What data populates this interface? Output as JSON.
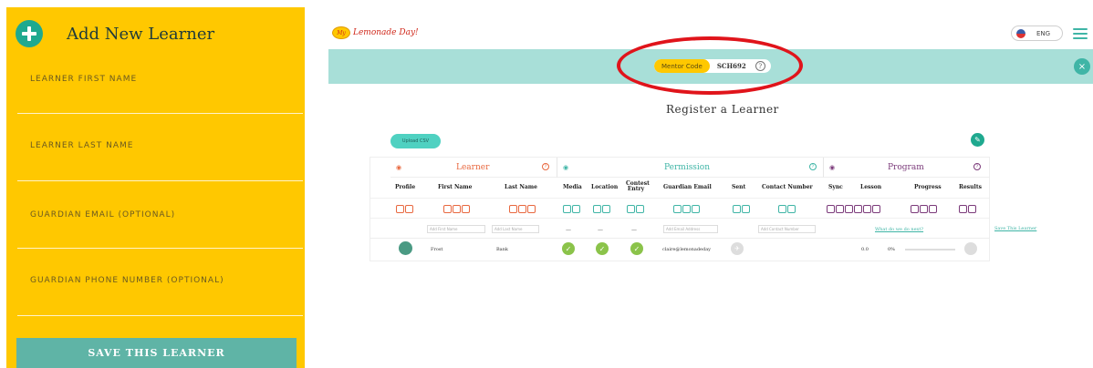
{
  "left_panel": {
    "title": "Add New Learner",
    "fields": [
      {
        "label": "LEARNER FIRST NAME"
      },
      {
        "label": "LEARNER LAST NAME"
      },
      {
        "label": "GUARDIAN EMAIL (OPTIONAL)"
      },
      {
        "label": "GUARDIAN PHONE NUMBER (OPTIONAL)"
      }
    ],
    "save_label": "SAVE THIS LEARNER"
  },
  "header": {
    "logo_mark": "My",
    "logo_text": "Lemonade Day!",
    "language": "ENG"
  },
  "banner": {
    "mentor_code_label": "Mentor Code",
    "mentor_code_value": "SCH692",
    "help_glyph": "?",
    "close_glyph": "×"
  },
  "main": {
    "title": "Register a Learner",
    "upload_label": "Upload CSV"
  },
  "table": {
    "groups": [
      {
        "title": "Learner",
        "color": "#e8683f"
      },
      {
        "title": "Permission",
        "color": "#3fb5a6"
      },
      {
        "title": "Program",
        "color": "#7b3a7a"
      }
    ],
    "columns": {
      "profile": "Profile",
      "first_name": "First Name",
      "last_name": "Last Name",
      "media": "Media",
      "location": "Location",
      "contest_entry": "Contest Entry",
      "guardian_email": "Guardian Email",
      "sent": "Sent",
      "contact_number": "Contact Number",
      "sync": "Sync",
      "lesson": "Lesson",
      "progress": "Progress",
      "results": "Results"
    },
    "placeholders": {
      "first_name": "Add First Name",
      "last_name": "Add Last Name",
      "email": "Add Email Address",
      "contact": "Add Contact Number"
    },
    "dash": "—",
    "what_next": "What do we do next?",
    "save_link": "Save This Learner",
    "row": {
      "first_name": "Frost",
      "last_name": "Bank",
      "guardian_email": "claire@lemonadeday",
      "lesson": "0.0",
      "progress": "0%"
    },
    "check_glyph": "✓"
  },
  "colors": {
    "yellow": "#ffc800",
    "teal": "#3fb5a6",
    "banner": "#a8dfd8",
    "highlight": "#e0141b"
  }
}
